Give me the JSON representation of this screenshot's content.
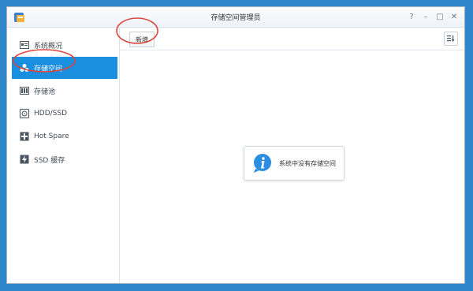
{
  "window": {
    "title": "存储空间管理员",
    "controls": [
      "?",
      "–",
      "□",
      "✕"
    ]
  },
  "sidebar": {
    "items": [
      {
        "label": "系统概况",
        "icon": "overview-icon",
        "active": false
      },
      {
        "label": "存储空间",
        "icon": "volume-icon",
        "active": true
      },
      {
        "label": "存储池",
        "icon": "storage-pool-icon",
        "active": false
      },
      {
        "label": "HDD/SSD",
        "icon": "disk-icon",
        "active": false
      },
      {
        "label": "Hot Spare",
        "icon": "hot-spare-icon",
        "active": false
      },
      {
        "label": "SSD 缓存",
        "icon": "ssd-cache-icon",
        "active": false
      }
    ]
  },
  "toolbar": {
    "new_label": "新增",
    "sort_icon": "sort-icon"
  },
  "main": {
    "empty_message": "系统中没有存储空间"
  },
  "colors": {
    "accent": "#1a8fe0",
    "annotation": "#d9463d",
    "desktop": "#2f86c9"
  }
}
